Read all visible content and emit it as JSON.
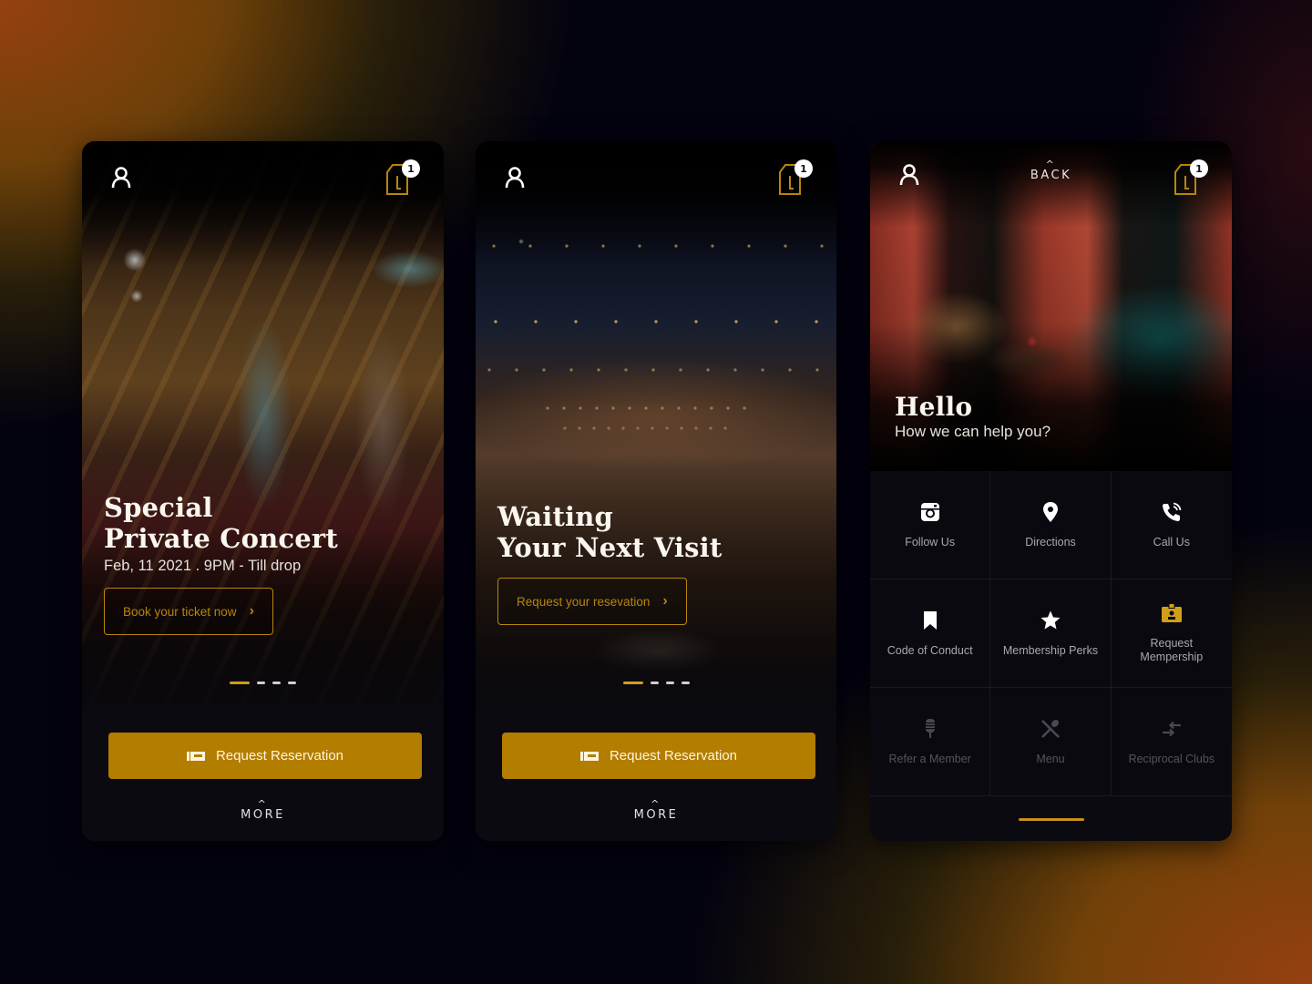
{
  "colors": {
    "accent": "#b37d00",
    "accent_text": "#b8860b",
    "indicator_active": "#d19e1a",
    "screen_bg": "#0b0a10"
  },
  "screens": [
    {
      "id": "concert",
      "badge_count": "1",
      "headline_line1": "Special",
      "headline_line2": "Private Concert",
      "subline": "Feb, 11 2021 . 9PM - Till drop",
      "cta_label": "Book your ticket now",
      "carousel": {
        "total": 4,
        "active": 1
      },
      "primary_button": "Request Reservation",
      "more_label": "MORE"
    },
    {
      "id": "visit",
      "badge_count": "1",
      "headline_line1": "Waiting",
      "headline_line2": "Your Next Visit",
      "cta_label": "Request your resevation",
      "carousel": {
        "total": 4,
        "active": 1
      },
      "primary_button": "Request Reservation",
      "more_label": "MORE"
    },
    {
      "id": "help",
      "badge_count": "1",
      "back_label": "BACK",
      "headline": "Hello",
      "subline": "How we can help you?",
      "menu": [
        {
          "label": "Follow Us",
          "icon": "instagram-icon",
          "enabled": true
        },
        {
          "label": "Directions",
          "icon": "map-pin-icon",
          "enabled": true
        },
        {
          "label": "Call Us",
          "icon": "phone-icon",
          "enabled": true
        },
        {
          "label": "Code of Conduct",
          "icon": "bookmark-icon",
          "enabled": true
        },
        {
          "label": "Membership Perks",
          "icon": "star-icon",
          "enabled": true
        },
        {
          "label": "Request Mempership",
          "icon": "id-badge-icon",
          "enabled": true
        },
        {
          "label": "Refer a Member",
          "icon": "microphone-icon",
          "enabled": false
        },
        {
          "label": "Menu",
          "icon": "utensils-icon",
          "enabled": false
        },
        {
          "label": "Reciprocal Clubs",
          "icon": "exchange-icon",
          "enabled": false
        }
      ]
    }
  ]
}
